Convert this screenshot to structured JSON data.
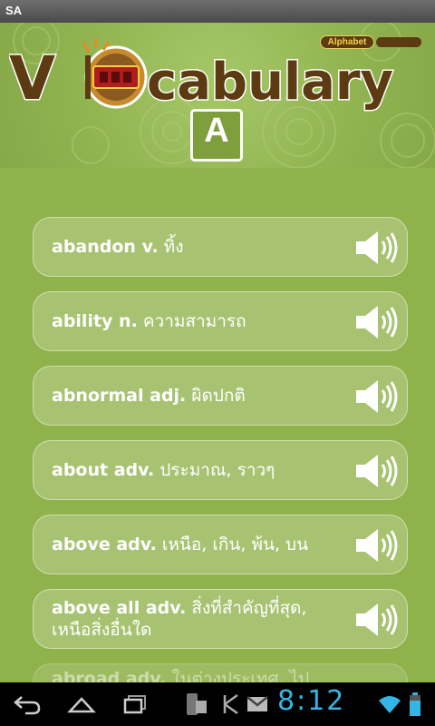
{
  "status_bar": {
    "label": "SA"
  },
  "header": {
    "title_first_letter": "V",
    "title_rest": "cabulary",
    "badge": "Alphabet",
    "current_letter": "A"
  },
  "entries": [
    {
      "word": "abandon v.",
      "meaning": "ทิ้ง"
    },
    {
      "word": "ability n.",
      "meaning": "ความสามารถ"
    },
    {
      "word": "abnormal adj.",
      "meaning": "ผิดปกติ"
    },
    {
      "word": "about adv.",
      "meaning": "ประมาณ, ราวๆ"
    },
    {
      "word": "above adv.",
      "meaning": "เหนือ, เกิน, พ้น, บน"
    },
    {
      "word": "above all adv.",
      "meaning": "สิ่งที่สำคัญที่สุด,",
      "meaning_line2": "เหนือสิ่งอื่นใด"
    },
    {
      "word": "abroad adv.",
      "meaning": "ในต่างประเทศ, ไปต่าง"
    }
  ],
  "nav_bar": {
    "time": "8:12"
  },
  "colors": {
    "background": "#8fb24a",
    "title_brown": "#5c3a12",
    "clock": "#33b5e5"
  }
}
